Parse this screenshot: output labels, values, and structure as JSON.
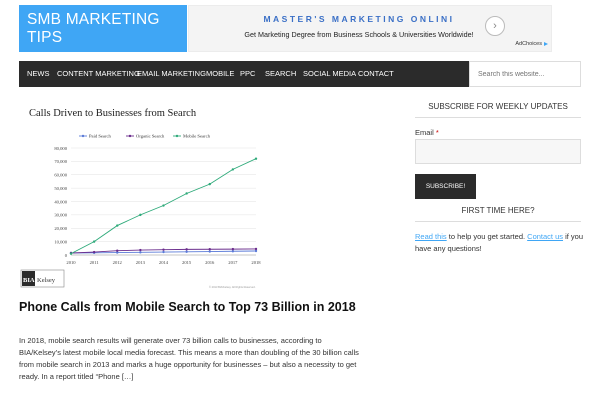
{
  "site": {
    "logo": "SMB MARKETING TIPS"
  },
  "ad": {
    "title": "MASTER'S MARKETING ONLINI",
    "subtitle": "Get Marketing Degree from Business Schools & Universities Worldwide!",
    "choices_label": "AdChoices",
    "arrow_icon": "chevron-right-icon"
  },
  "nav": {
    "items": [
      "News",
      "Content Marketing",
      "Email Marketing",
      "Mobile",
      "PPC",
      "Search",
      "Social Media",
      "Contact"
    ],
    "search_placeholder": "Search this website..."
  },
  "chart_data": {
    "type": "line",
    "title": "Calls Driven to Businesses from Search",
    "categories": [
      "2010",
      "2011",
      "2012",
      "2013",
      "2014",
      "2015",
      "2016",
      "2017",
      "2018"
    ],
    "ylim": [
      0,
      80000
    ],
    "yticks": [
      "0",
      "10,000",
      "20,000",
      "30,000",
      "40,000",
      "50,000",
      "60,000",
      "70,000",
      "80,000"
    ],
    "series": [
      {
        "name": "Paid Search",
        "color": "#5b7bd8",
        "values": [
          1500,
          1600,
          1800,
          2000,
          2200,
          2400,
          2600,
          2800,
          3000
        ]
      },
      {
        "name": "Organic Search",
        "color": "#6a2c8c",
        "values": [
          1500,
          2200,
          3200,
          3700,
          4000,
          4200,
          4300,
          4400,
          4500
        ]
      },
      {
        "name": "Mobile Search",
        "color": "#2eaa7a",
        "values": [
          1000,
          10000,
          22000,
          30000,
          37000,
          46000,
          53000,
          64000,
          72000
        ]
      }
    ],
    "source_logo": "BIA Kelsey",
    "copyright": "© 2013 BIA/Kelsey. All Rights Reserved."
  },
  "article": {
    "title": "Phone Calls from Mobile Search to Top 73 Billion in 2018",
    "excerpt": "In 2018, mobile search results will generate over 73 billion calls to businesses, according to BIA/Kelsey’s latest mobile local media forecast. This means a more than doubling of the 30 billion calls from mobile search in 2013 and marks a huge opportunity for businesses – but also a necessity to get ready. In a report titled “Phone […]"
  },
  "sidebar": {
    "subscribe_heading": "Subscribe for Weekly Updates",
    "email_label": "Email",
    "required_mark": "*",
    "subscribe_button": "Subscribe!",
    "first_time_heading": "First Time Here?",
    "read_this_link": "Read this",
    "text_middle": " to help you get started. ",
    "contact_link": "Contact us",
    "text_end": " if you have any questions!"
  }
}
